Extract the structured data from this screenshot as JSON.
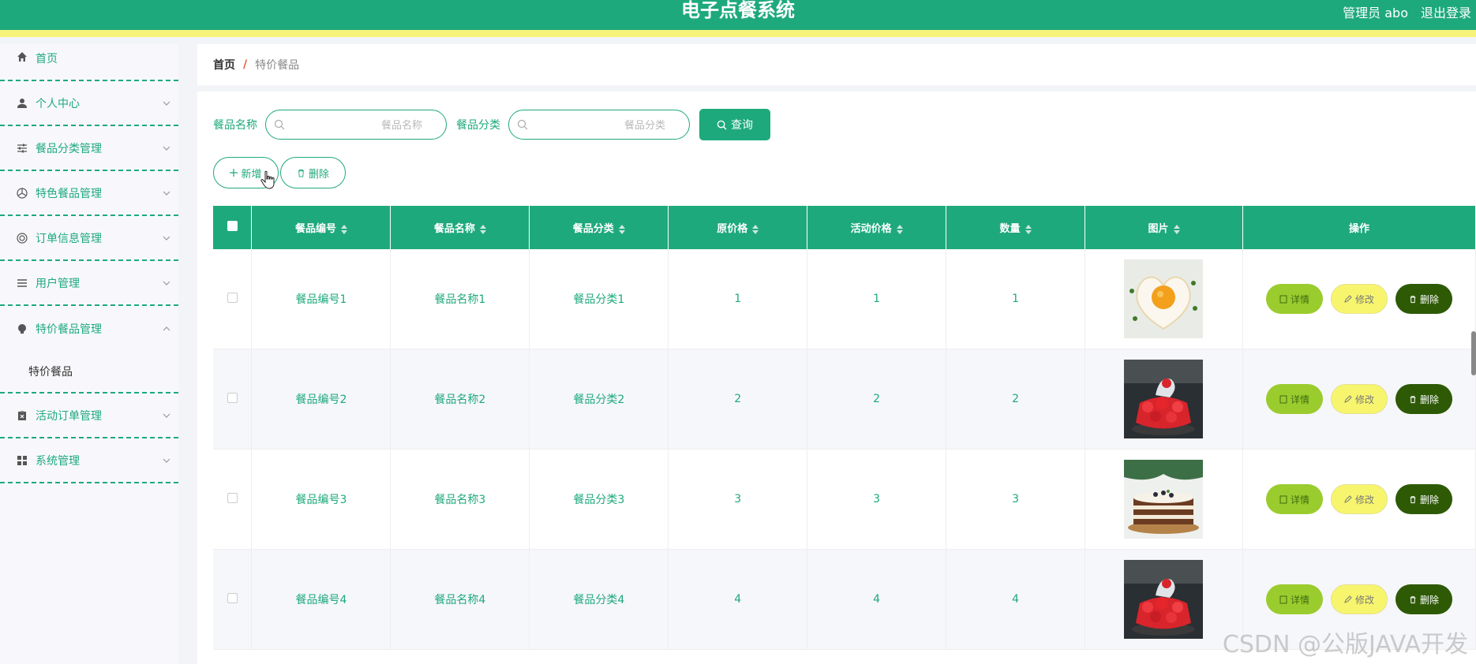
{
  "header": {
    "title": "电子点餐系统",
    "user": "管理员 abo",
    "logout": "退出登录"
  },
  "sidebar": {
    "items": [
      {
        "label": "首页",
        "icon": "home-icon"
      },
      {
        "label": "个人中心",
        "icon": "user-icon"
      },
      {
        "label": "餐品分类管理",
        "icon": "sliders-icon"
      },
      {
        "label": "特色餐品管理",
        "icon": "aperture-icon"
      },
      {
        "label": "订单信息管理",
        "icon": "lifebuoy-icon"
      },
      {
        "label": "用户管理",
        "icon": "list-icon"
      },
      {
        "label": "特价餐品管理",
        "icon": "bulb-icon"
      },
      {
        "label": "活动订单管理",
        "icon": "clipboard-icon"
      },
      {
        "label": "系统管理",
        "icon": "grid-icon"
      }
    ],
    "submenu": {
      "label": "特价餐品"
    }
  },
  "breadcrumb": {
    "home": "首页",
    "separator": "/",
    "current": "特价餐品"
  },
  "search": {
    "name_label": "餐品名称",
    "name_placeholder": "餐品名称",
    "category_label": "餐品分类",
    "category_placeholder": "餐品分类",
    "query_button": "查询"
  },
  "actions": {
    "add": "新增",
    "delete": "删除"
  },
  "table": {
    "columns": [
      "餐品编号",
      "餐品名称",
      "餐品分类",
      "原价格",
      "活动价格",
      "数量",
      "图片",
      "操作"
    ],
    "rows": [
      {
        "code": "餐品编号1",
        "name": "餐品名称1",
        "category": "餐品分类1",
        "price": "1",
        "promo": "1",
        "qty": "1",
        "image": "heart-egg-photo"
      },
      {
        "code": "餐品编号2",
        "name": "餐品名称2",
        "category": "餐品分类2",
        "price": "2",
        "promo": "2",
        "qty": "2",
        "image": "strawberry-bingsu-photo"
      },
      {
        "code": "餐品编号3",
        "name": "餐品名称3",
        "category": "餐品分类3",
        "price": "3",
        "promo": "3",
        "qty": "3",
        "image": "layer-cake-photo"
      },
      {
        "code": "餐品编号4",
        "name": "餐品名称4",
        "category": "餐品分类4",
        "price": "4",
        "promo": "4",
        "qty": "4",
        "image": "strawberry-bingsu-photo"
      }
    ],
    "op_labels": {
      "detail": "详情",
      "edit": "修改",
      "delete": "删除"
    }
  },
  "watermark": "CSDN @公版JAVA开发",
  "colors": {
    "primary": "#1ea97c",
    "accent_bar": "#f6f27a",
    "detail_btn": "#9bcc2e",
    "edit_btn": "#f7f56e",
    "delete_btn": "#2e5a06"
  }
}
